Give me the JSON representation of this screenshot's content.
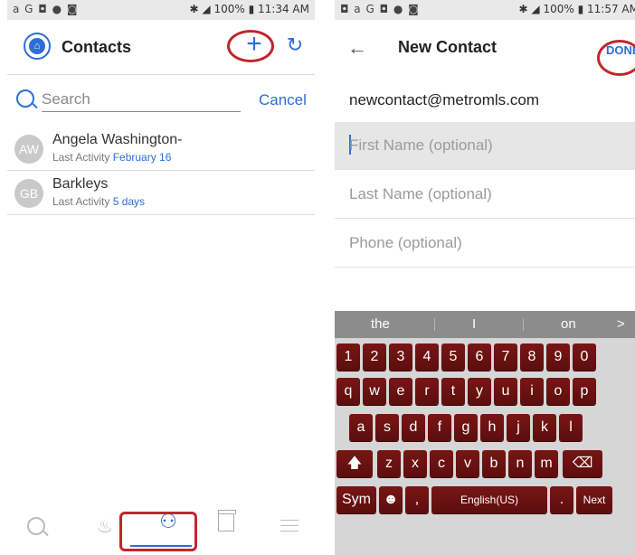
{
  "left": {
    "status": {
      "icons": "a G ◘ ● ◙",
      "battery": "100%",
      "time": "11:34 AM"
    },
    "header": {
      "title": "Contacts",
      "plus": "+",
      "refresh": "C"
    },
    "search": {
      "placeholder": "Search",
      "cancel": "Cancel"
    },
    "contacts": [
      {
        "initials": "AW",
        "name": "Angela Washington-",
        "activity_label": "Last Activity",
        "activity_value": "February 16"
      },
      {
        "initials": "GB",
        "name": "Barkleys",
        "activity_label": "Last Activity",
        "activity_value": "5 days"
      }
    ],
    "nav": [
      "search-icon",
      "hotlist-icon",
      "contacts-icon",
      "listings-icon",
      "menu-icon"
    ]
  },
  "right": {
    "status": {
      "icons": "◘ a G ◘ ● ◙",
      "battery": "100%",
      "time": "11:57 AM"
    },
    "header": {
      "title": "New Contact",
      "done": "DONE"
    },
    "email": "newcontact@metromls.com",
    "fields": [
      "First Name (optional)",
      "Last Name (optional)",
      "Phone (optional)"
    ],
    "keyboard": {
      "suggestions": [
        "the",
        "I",
        "on"
      ],
      "row1": [
        "1",
        "2",
        "3",
        "4",
        "5",
        "6",
        "7",
        "8",
        "9",
        "0"
      ],
      "row2": [
        "q",
        "w",
        "e",
        "r",
        "t",
        "y",
        "u",
        "i",
        "o",
        "p"
      ],
      "row3": [
        "a",
        "s",
        "d",
        "f",
        "g",
        "h",
        "j",
        "k",
        "l"
      ],
      "row4": [
        "z",
        "x",
        "c",
        "v",
        "b",
        "n",
        "m"
      ],
      "sym": "Sym",
      "space": "English(US)",
      "next": "Next"
    }
  }
}
